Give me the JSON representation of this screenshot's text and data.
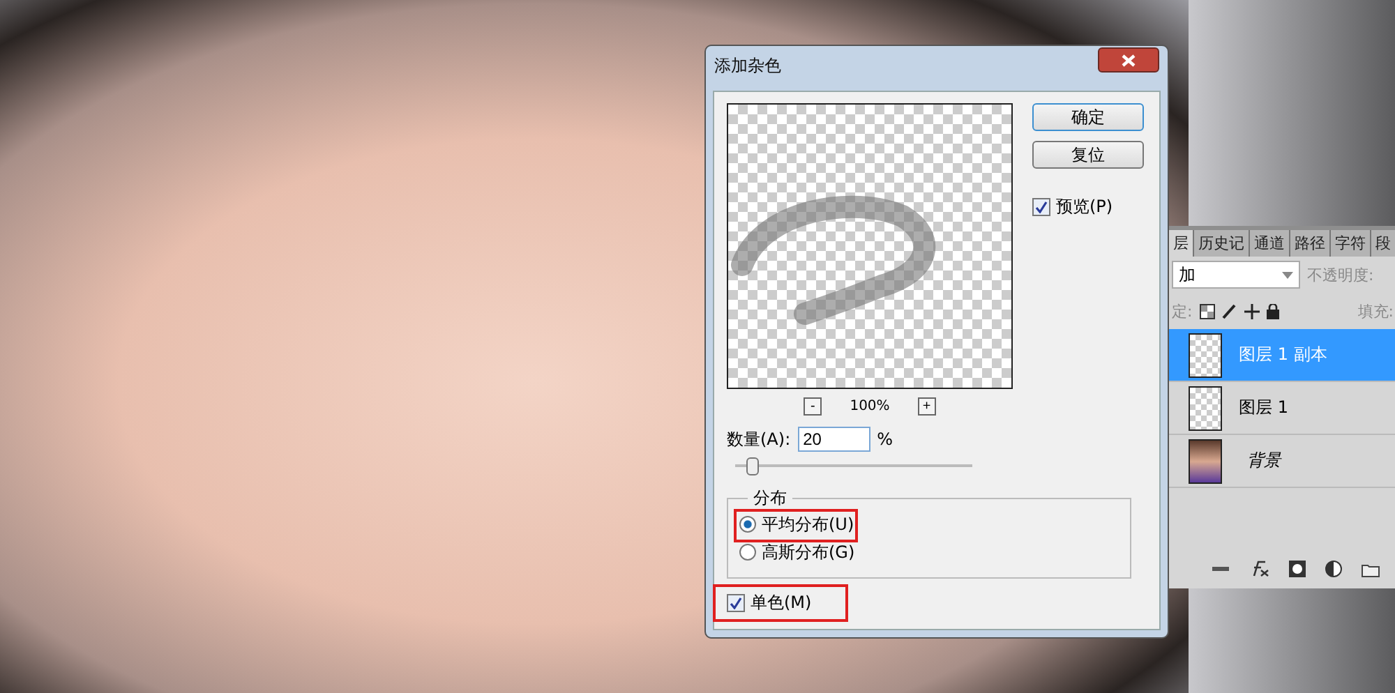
{
  "dialog": {
    "title": "添加杂色",
    "buttons": [
      {
        "label": "确定",
        "default": true
      },
      {
        "label": "复位",
        "default": false
      }
    ],
    "preview_toggle": {
      "label": "预览(P)",
      "checked": true
    },
    "zoom": {
      "minus": "-",
      "value": "100%",
      "plus": "+"
    },
    "amount": {
      "label": "数量(A):",
      "value": "20",
      "unit": "%",
      "level": 0.07
    },
    "distribution": {
      "title": "分布",
      "options": [
        {
          "label": "平均分布(U)",
          "selected": true,
          "highlighted": true
        },
        {
          "label": "高斯分布(G)",
          "selected": false,
          "highlighted": false
        }
      ]
    },
    "monochrome": {
      "label": "单色(M)",
      "checked": true,
      "highlighted": true
    }
  },
  "layers_panel": {
    "tabs": [
      {
        "label": "层",
        "selected": true
      },
      {
        "label": "历史记",
        "selected": false
      },
      {
        "label": "通道",
        "selected": false
      },
      {
        "label": "路径",
        "selected": false
      },
      {
        "label": "字符",
        "selected": false
      },
      {
        "label": "段",
        "selected": false
      }
    ],
    "blend_mode": "加",
    "opacity_label": "不透明度:",
    "lock_label": "定:",
    "fill_label": "填充:",
    "layers": [
      {
        "name": "图层 1 副本",
        "selected": true,
        "kind": "transparent"
      },
      {
        "name": "图层 1",
        "selected": false,
        "kind": "transparent"
      },
      {
        "name": "背景",
        "selected": false,
        "kind": "photo"
      }
    ]
  }
}
